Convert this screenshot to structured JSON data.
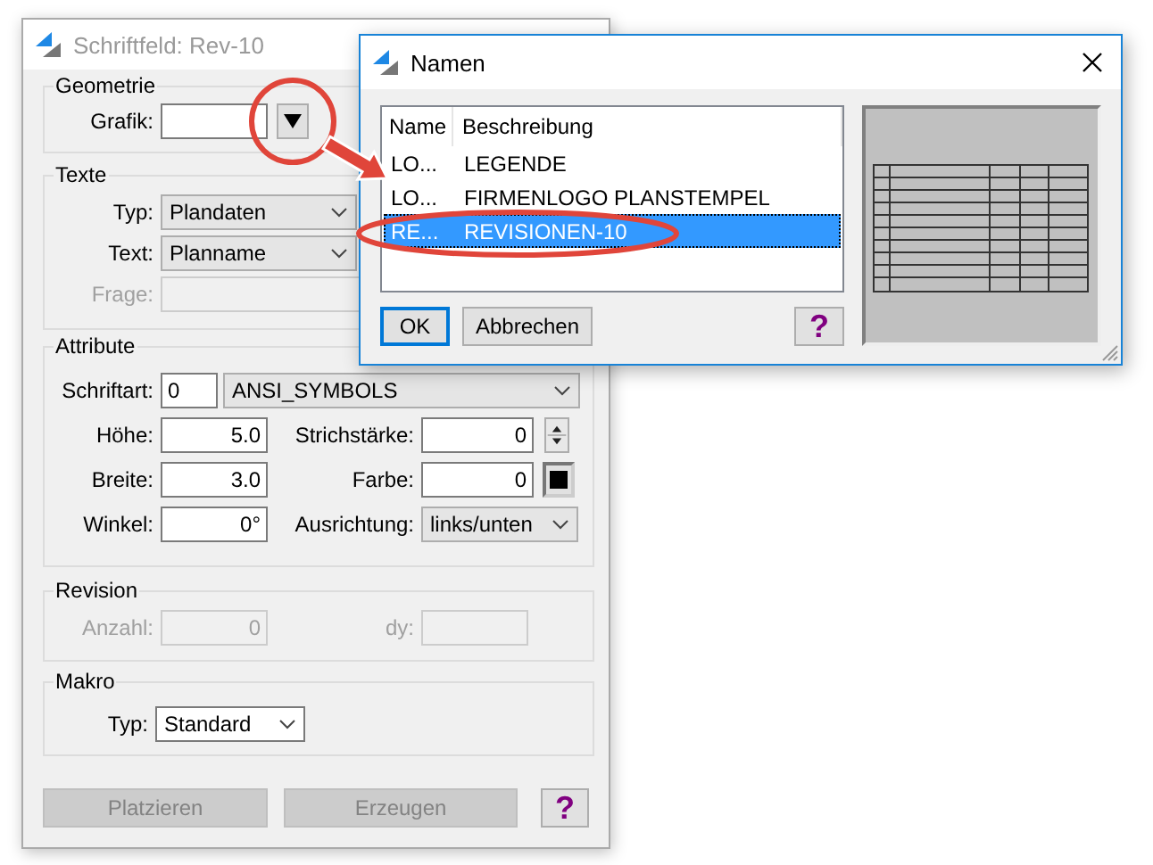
{
  "main_window": {
    "title": "Schriftfeld: Rev-10",
    "active": false,
    "geometrie": {
      "legend": "Geometrie",
      "grafik": {
        "label": "Grafik:"
      }
    },
    "texte": {
      "legend": "Texte",
      "typ": {
        "label": "Typ:",
        "value": "Plandaten"
      },
      "text": {
        "label": "Text:",
        "value": "Planname"
      },
      "frage": {
        "label": "Frage:",
        "disabled": true
      }
    },
    "attribute": {
      "legend": "Attribute",
      "schriftart": {
        "label": "Schriftart:",
        "number": "0",
        "value": "ANSI_SYMBOLS"
      },
      "hoehe": {
        "label": "Höhe:",
        "value": "5.0"
      },
      "strichstaerke": {
        "label": "Strichstärke:",
        "value": "0"
      },
      "breite": {
        "label": "Breite:",
        "value": "3.0"
      },
      "farbe": {
        "label": "Farbe:",
        "value": "0"
      },
      "winkel": {
        "label": "Winkel:",
        "value": "0°"
      },
      "ausrichtung": {
        "label": "Ausrichtung:",
        "value": "links/unten"
      }
    },
    "revision": {
      "legend": "Revision",
      "anzahl": {
        "label": "Anzahl:",
        "value": "0",
        "disabled": true
      },
      "dy": {
        "label": "dy:",
        "disabled": true
      }
    },
    "makro": {
      "legend": "Makro",
      "typ": {
        "label": "Typ:",
        "value": "Standard"
      }
    },
    "buttons": [
      {
        "label": "Platzieren",
        "disabled": true
      },
      {
        "label": "Erzeugen",
        "disabled": true
      }
    ],
    "help": "?"
  },
  "namen_dialog": {
    "title": "Namen",
    "active": true,
    "columns": [
      "Name",
      "Beschreibung"
    ],
    "rows": [
      {
        "name": "LO...",
        "beschreibung": "LEGENDE",
        "selected": false
      },
      {
        "name": "LO...",
        "beschreibung": "FIRMENLOGO PLANSTEMPEL",
        "selected": false
      },
      {
        "name": "RE...",
        "beschreibung": "REVISIONEN-10",
        "selected": true
      }
    ],
    "buttons": [
      {
        "label": "OK",
        "default": true
      },
      {
        "label": "Abbrechen",
        "default": false
      }
    ],
    "help": "?"
  }
}
